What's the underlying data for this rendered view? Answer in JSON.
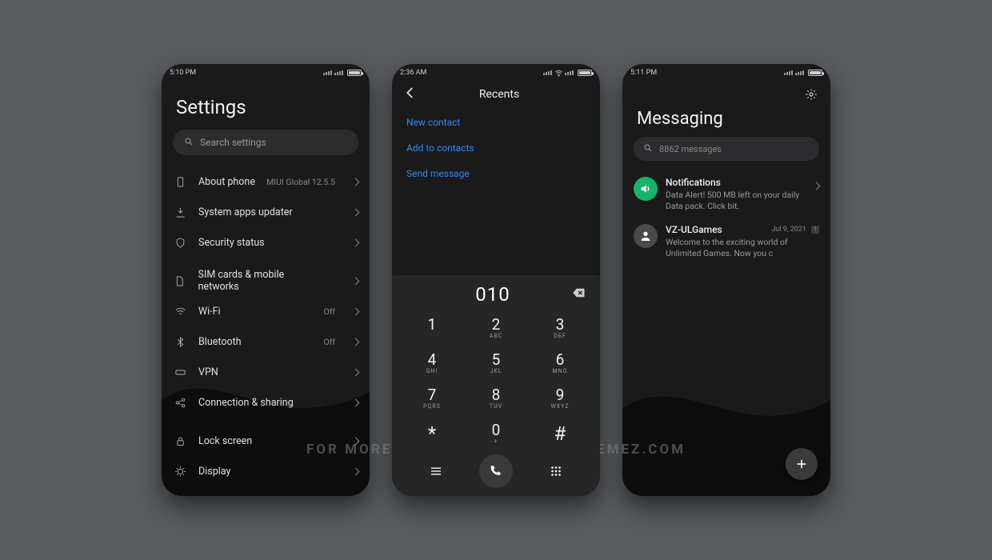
{
  "watermark": "FOR MORE THEMES VISIT - MIUITHEMEZ.COM",
  "settings": {
    "time": "5:10 PM",
    "title": "Settings",
    "search_placeholder": "Search settings",
    "items": [
      {
        "icon": "phone-info",
        "label": "About phone",
        "meta": "MIUI Global 12.5.5"
      },
      {
        "icon": "updater",
        "label": "System apps updater",
        "meta": ""
      },
      {
        "icon": "shield",
        "label": "Security status",
        "meta": ""
      },
      {
        "icon": "sim",
        "label": "SIM cards & mobile networks",
        "meta": ""
      },
      {
        "icon": "wifi",
        "label": "Wi-Fi",
        "meta": "Off"
      },
      {
        "icon": "bluetooth",
        "label": "Bluetooth",
        "meta": "Off"
      },
      {
        "icon": "vpn",
        "label": "VPN",
        "meta": ""
      },
      {
        "icon": "share",
        "label": "Connection & sharing",
        "meta": ""
      },
      {
        "icon": "lock",
        "label": "Lock screen",
        "meta": ""
      },
      {
        "icon": "display",
        "label": "Display",
        "meta": ""
      }
    ]
  },
  "dialer": {
    "time": "2:36 AM",
    "title": "Recents",
    "links": {
      "new_contact": "New contact",
      "add_to_contacts": "Add to contacts",
      "send_message": "Send message"
    },
    "dialed_number": "010",
    "keys": [
      {
        "d": "1",
        "l": ""
      },
      {
        "d": "2",
        "l": "ABC"
      },
      {
        "d": "3",
        "l": "DEF"
      },
      {
        "d": "4",
        "l": "GHI"
      },
      {
        "d": "5",
        "l": "JKL"
      },
      {
        "d": "6",
        "l": "MNO"
      },
      {
        "d": "7",
        "l": "PQRS"
      },
      {
        "d": "8",
        "l": "TUV"
      },
      {
        "d": "9",
        "l": "WXYZ"
      },
      {
        "d": "*",
        "l": ""
      },
      {
        "d": "0",
        "l": "+"
      },
      {
        "d": "#",
        "l": ""
      }
    ]
  },
  "messaging": {
    "time": "5:11 PM",
    "title": "Messaging",
    "search_placeholder": "8862 messages",
    "conversations": [
      {
        "avatar": "speaker",
        "name": "Notifications",
        "date": "",
        "preview": "Data Alert! 500 MB left on your daily Data pack. Click bit.",
        "has_chevron": true
      },
      {
        "avatar": "person",
        "name": "VZ-ULGames",
        "date": "Jul 9, 2021",
        "badge": "1",
        "preview": "Welcome to the exciting world of Unlimited Games. Now you c",
        "has_chevron": false
      }
    ]
  }
}
